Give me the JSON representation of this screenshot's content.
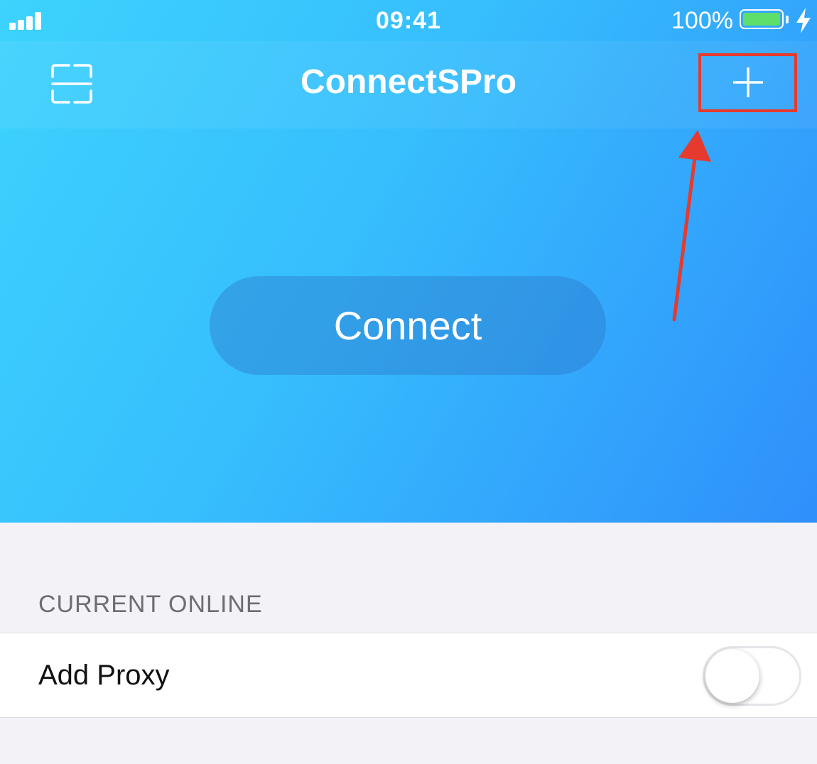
{
  "status_bar": {
    "time": "09:41",
    "battery_percent": "100%",
    "signal_icon": "cellular-signal-icon",
    "battery_icon": "battery-icon",
    "charging_icon": "lightning-bolt-icon"
  },
  "nav": {
    "title": "ConnectSPro",
    "scan_icon": "qr-scan-icon",
    "add_icon": "plus-icon"
  },
  "hero": {
    "connect_label": "Connect"
  },
  "section": {
    "header": "CURRENT ONLINE"
  },
  "proxy_row": {
    "label": "Add Proxy",
    "toggle_on": false
  },
  "colors": {
    "gradient_start": "#3dd3fd",
    "gradient_end": "#2f8ffb",
    "highlight_red": "#e63a2e",
    "battery_green": "#5ede6a",
    "grouped_background": "#f2f2f7"
  }
}
